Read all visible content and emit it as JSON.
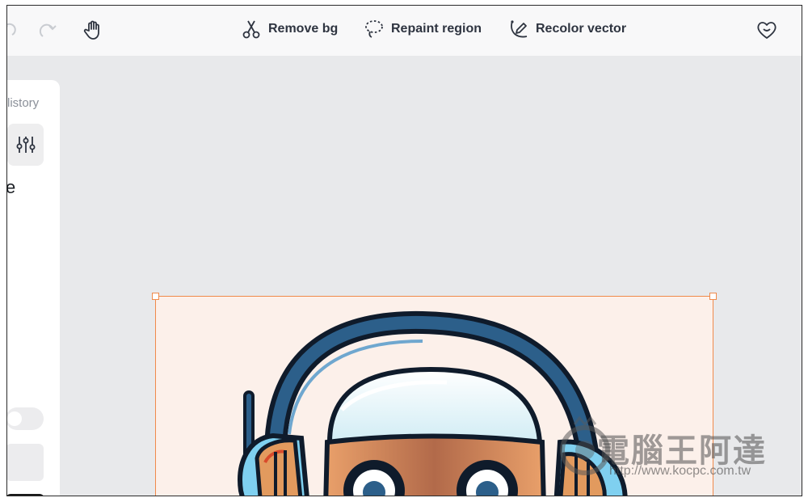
{
  "toolbar": {
    "tools": [
      {
        "label": "Remove bg",
        "icon": "scissors-icon"
      },
      {
        "label": "Repaint region",
        "icon": "lasso-icon"
      },
      {
        "label": "Recolor vector",
        "icon": "recolor-pen-icon"
      }
    ],
    "icons": [
      "undo-icon",
      "redo-icon",
      "hand-pan-icon",
      "heart-smile-icon"
    ]
  },
  "left_panel": {
    "history_label": "listory",
    "heading_fragment": "e"
  },
  "watermark": {
    "title": "電腦王阿達",
    "url": "http://www.kocpc.com.tw"
  },
  "colors": {
    "accent": "#f08a4b",
    "canvas_bg": "#e8e9eb",
    "artboard_bg": "#fcf0ea"
  }
}
